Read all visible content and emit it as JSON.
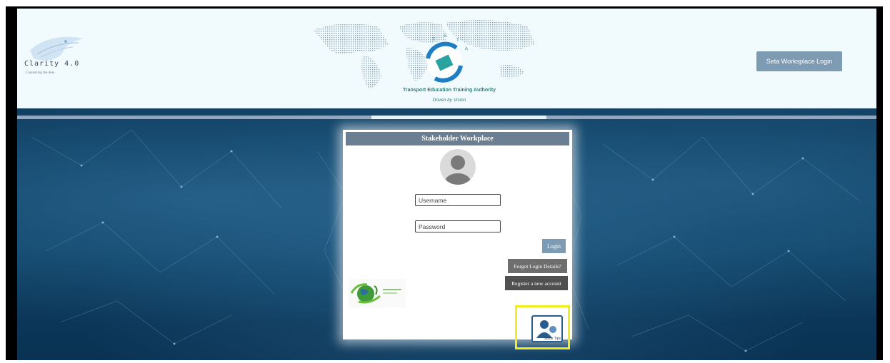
{
  "header": {
    "app_logo_title": "Clarity 4.0",
    "app_logo_subtitle": "Connecting the dots",
    "org_name": "Transport Education Training Authority",
    "tagline": "Driven by Vision",
    "seta_login_label": "Seta Worksplace Login"
  },
  "progress": {
    "fraction": 0.2
  },
  "login_panel": {
    "title": "Stakeholder Workplace",
    "username_placeholder": "Username",
    "password_placeholder": "Password",
    "login_label": "Login",
    "forgot_label": "Forgot Login Details?",
    "register_label": "Register a new account",
    "tips_label": "Some Tips"
  },
  "colors": {
    "header_bg": "#f1fbfd",
    "accent_button": "#7d9bb3",
    "panel_header": "#6c7f92",
    "highlight": "#f2ee1c",
    "teal_text": "#2f7f7a"
  },
  "icons": [
    "clarity-logo-icon",
    "teta-globe-logo-icon",
    "user-avatar-icon",
    "eco-earth-logo-icon",
    "tips-user-icon"
  ]
}
